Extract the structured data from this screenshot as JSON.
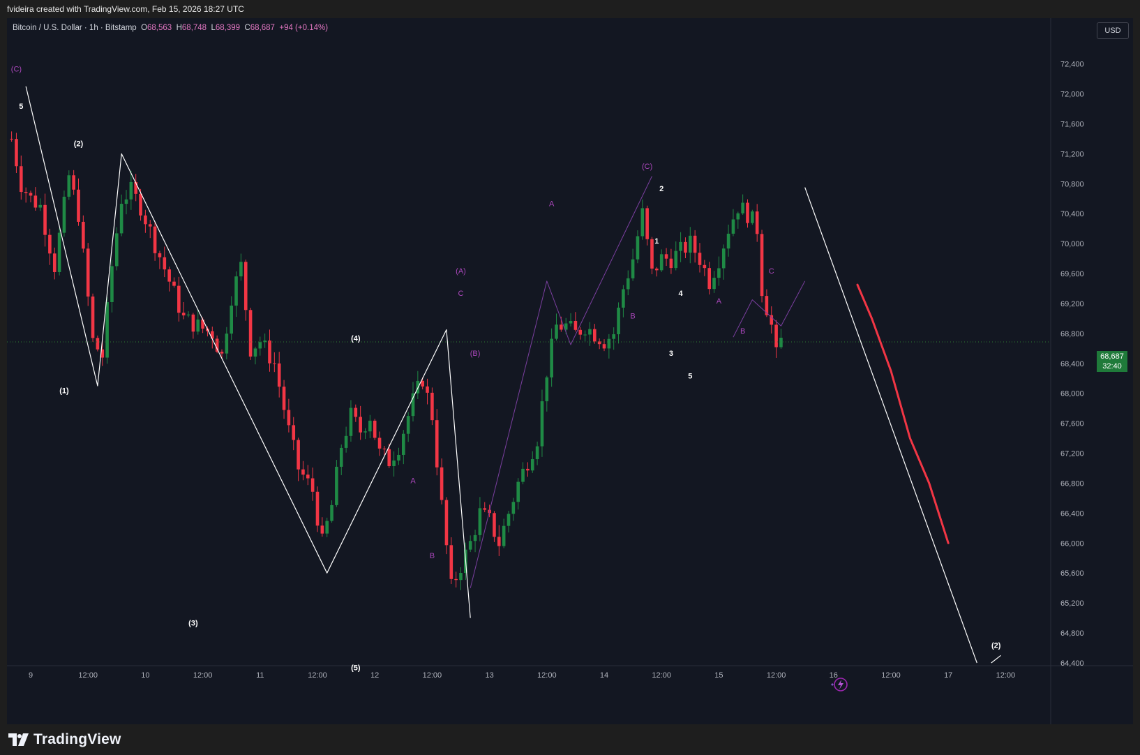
{
  "header": {
    "attribution": "fvideira created with TradingView.com, Feb 15, 2026 18:27 UTC"
  },
  "legend": {
    "symbol": "Bitcoin / U.S. Dollar · 1h · Bitstamp",
    "open_label": "O",
    "open": "68,563",
    "high_label": "H",
    "high": "68,748",
    "low_label": "L",
    "low": "68,399",
    "close_label": "C",
    "close": "68,687",
    "change": "+94 (+0.14%)"
  },
  "currency_button": "USD",
  "last_price": {
    "value": "68,687",
    "countdown": "32:40"
  },
  "brand": "TradingView",
  "colors": {
    "up": "#26a69a",
    "up_body": "#1b7f3a",
    "down": "#f23645",
    "background": "#131722",
    "wave_white": "#ffffff",
    "wave_purple": "#9c27b0",
    "projection": "#f23645"
  },
  "chart_data": {
    "type": "candlestick",
    "symbol": "BTCUSD",
    "interval": "1h",
    "exchange": "Bitstamp",
    "ylim": [
      64400,
      72600
    ],
    "y_ticks": [
      64400,
      64800,
      65200,
      65600,
      66000,
      66400,
      66800,
      67200,
      67600,
      68000,
      68400,
      68800,
      69200,
      69600,
      70000,
      70400,
      70800,
      71200,
      71600,
      72000,
      72400
    ],
    "y_tick_labels": [
      "64,400",
      "64,800",
      "65,200",
      "65,600",
      "66,000",
      "66,400",
      "66,800",
      "67,200",
      "67,600",
      "68,000",
      "68,400",
      "68,800",
      "69,200",
      "69,600",
      "70,000",
      "70,400",
      "70,800",
      "71,200",
      "71,600",
      "72,000",
      "72,400"
    ],
    "x_ticks": [
      {
        "t": 0,
        "label": "9"
      },
      {
        "t": 12,
        "label": "12:00"
      },
      {
        "t": 24,
        "label": "10"
      },
      {
        "t": 36,
        "label": "12:00"
      },
      {
        "t": 48,
        "label": "11"
      },
      {
        "t": 60,
        "label": "12:00"
      },
      {
        "t": 72,
        "label": "12"
      },
      {
        "t": 84,
        "label": "12:00"
      },
      {
        "t": 96,
        "label": "13"
      },
      {
        "t": 108,
        "label": "12:00"
      },
      {
        "t": 120,
        "label": "14"
      },
      {
        "t": 132,
        "label": "12:00"
      },
      {
        "t": 144,
        "label": "15"
      },
      {
        "t": 156,
        "label": "12:00"
      },
      {
        "t": 168,
        "label": "16"
      },
      {
        "t": 180,
        "label": "12:00"
      },
      {
        "t": 192,
        "label": "17"
      },
      {
        "t": 204,
        "label": "12:00"
      }
    ],
    "x_unit": "hours since Feb 9 00:00 UTC",
    "price_anchors": [
      [
        -4,
        71400
      ],
      [
        -2,
        70800
      ],
      [
        0,
        70600
      ],
      [
        2,
        70500
      ],
      [
        5,
        69700
      ],
      [
        8,
        70900
      ],
      [
        10,
        70400
      ],
      [
        13,
        68700
      ],
      [
        15,
        68500
      ],
      [
        17,
        69700
      ],
      [
        19,
        70600
      ],
      [
        21,
        70700
      ],
      [
        23,
        70500
      ],
      [
        26,
        70000
      ],
      [
        29,
        69500
      ],
      [
        32,
        69000
      ],
      [
        35,
        68900
      ],
      [
        38,
        68800
      ],
      [
        40,
        68500
      ],
      [
        42,
        69300
      ],
      [
        44,
        69700
      ],
      [
        46,
        68600
      ],
      [
        48,
        68700
      ],
      [
        51,
        68400
      ],
      [
        54,
        67500
      ],
      [
        56,
        67000
      ],
      [
        59,
        66700
      ],
      [
        61,
        66000
      ],
      [
        63,
        66500
      ],
      [
        65,
        67300
      ],
      [
        67,
        67700
      ],
      [
        69,
        67500
      ],
      [
        71,
        67700
      ],
      [
        73,
        67200
      ],
      [
        75,
        67100
      ],
      [
        77,
        67300
      ],
      [
        80,
        67900
      ],
      [
        82,
        68200
      ],
      [
        84,
        67700
      ],
      [
        86,
        66500
      ],
      [
        88,
        65400
      ],
      [
        90,
        65700
      ],
      [
        92,
        66000
      ],
      [
        94,
        66400
      ],
      [
        96,
        66300
      ],
      [
        98,
        66000
      ],
      [
        100,
        66400
      ],
      [
        102,
        66800
      ],
      [
        104,
        67100
      ],
      [
        106,
        67400
      ],
      [
        108,
        68300
      ],
      [
        110,
        68900
      ],
      [
        112,
        68900
      ],
      [
        114,
        68800
      ],
      [
        116,
        68900
      ],
      [
        118,
        68800
      ],
      [
        120,
        68700
      ],
      [
        122,
        68800
      ],
      [
        124,
        69400
      ],
      [
        126,
        69800
      ],
      [
        128,
        70400
      ],
      [
        130,
        69600
      ],
      [
        132,
        69800
      ],
      [
        134,
        69800
      ],
      [
        136,
        69900
      ],
      [
        138,
        70000
      ],
      [
        140,
        69800
      ],
      [
        142,
        69500
      ],
      [
        144,
        69800
      ],
      [
        146,
        70200
      ],
      [
        148,
        70500
      ],
      [
        150,
        70400
      ],
      [
        152,
        70200
      ],
      [
        153,
        69400
      ],
      [
        155,
        68900
      ],
      [
        156,
        68500
      ],
      [
        157,
        68700
      ]
    ],
    "projection": {
      "type": "line",
      "color": "#f23645",
      "points": [
        [
          173,
          69450
        ],
        [
          176,
          69000
        ],
        [
          180,
          68300
        ],
        [
          184,
          67400
        ],
        [
          188,
          66800
        ],
        [
          192,
          66000
        ]
      ]
    },
    "wave_labels": [
      {
        "t": -3,
        "p": 72300,
        "text": "(C)",
        "color": "purple"
      },
      {
        "t": -2,
        "p": 71800,
        "text": "5",
        "color": "white"
      },
      {
        "t": 10,
        "p": 71300,
        "text": "(2)",
        "color": "white"
      },
      {
        "t": 7,
        "p": 68000,
        "text": "(1)",
        "color": "white"
      },
      {
        "t": 34,
        "p": 64900,
        "text": "(3)",
        "color": "white"
      },
      {
        "t": 68,
        "p": 68700,
        "text": "(4)",
        "color": "white"
      },
      {
        "t": 68,
        "p": 64300,
        "text": "(5)",
        "color": "white"
      },
      {
        "t": 90,
        "p": 69600,
        "text": "(A)",
        "color": "purple"
      },
      {
        "t": 90,
        "p": 69300,
        "text": "C",
        "color": "purple"
      },
      {
        "t": 93,
        "p": 68500,
        "text": "(B)",
        "color": "purple"
      },
      {
        "t": 80,
        "p": 66800,
        "text": "A",
        "color": "purple"
      },
      {
        "t": 84,
        "p": 65800,
        "text": "B",
        "color": "purple"
      },
      {
        "t": 109,
        "p": 70500,
        "text": "A",
        "color": "purple"
      },
      {
        "t": 126,
        "p": 69000,
        "text": "B",
        "color": "purple"
      },
      {
        "t": 129,
        "p": 71000,
        "text": "(C)",
        "color": "purple"
      },
      {
        "t": 132,
        "p": 70700,
        "text": "2",
        "color": "white"
      },
      {
        "t": 131,
        "p": 70000,
        "text": "1",
        "color": "white"
      },
      {
        "t": 136,
        "p": 69300,
        "text": "4",
        "color": "white"
      },
      {
        "t": 134,
        "p": 68500,
        "text": "3",
        "color": "white"
      },
      {
        "t": 138,
        "p": 68200,
        "text": "5",
        "color": "white"
      },
      {
        "t": 144,
        "p": 69200,
        "text": "A",
        "color": "purple"
      },
      {
        "t": 149,
        "p": 68800,
        "text": "B",
        "color": "purple"
      },
      {
        "t": 155,
        "p": 69600,
        "text": "C",
        "color": "purple"
      },
      {
        "t": 202,
        "p": 64600,
        "text": "(2)",
        "color": "white"
      }
    ]
  }
}
